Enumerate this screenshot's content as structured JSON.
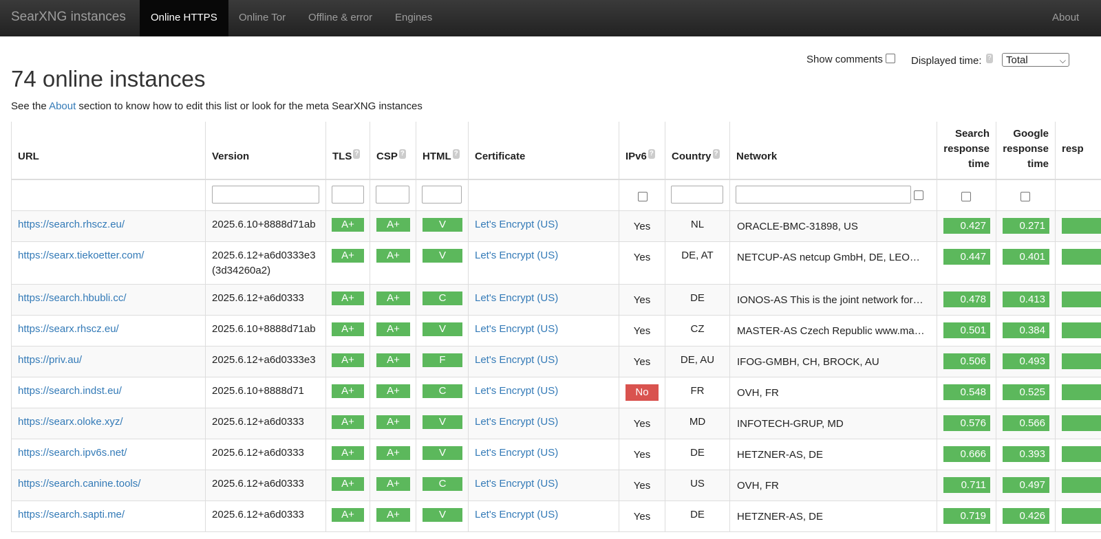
{
  "navbar": {
    "brand": "SearXNG instances",
    "tabs": [
      "Online HTTPS",
      "Online Tor",
      "Offline & error",
      "Engines"
    ],
    "about": "About"
  },
  "controls": {
    "show_comments": "Show comments",
    "displayed_time": "Displayed time:",
    "time_select": "Total"
  },
  "heading": "74 online instances",
  "subtitle": {
    "before": "See the ",
    "link": "About",
    "after": " section to know how to edit this list or look for the meta SearXNG instances"
  },
  "table": {
    "headers": {
      "url": "URL",
      "version": "Version",
      "tls": "TLS",
      "csp": "CSP",
      "html": "HTML",
      "certificate": "Certificate",
      "ipv6": "IPv6",
      "country": "Country",
      "network": "Network",
      "search": [
        "Search",
        "response",
        "time"
      ],
      "google": [
        "Google",
        "response",
        "time"
      ],
      "partial": "resp"
    },
    "rows": [
      {
        "url": "https://search.rhscz.eu/",
        "version": "2025.6.10+8888d71ab",
        "version2": "",
        "tls": "A+",
        "csp": "A+",
        "html": "V",
        "cert": "Let's Encrypt (US)",
        "ipv6": "Yes",
        "country": "NL",
        "network": "ORACLE-BMC-31898, US",
        "search": "0.427",
        "google": "0.271"
      },
      {
        "url": "https://searx.tiekoetter.com/",
        "version": "2025.6.12+a6d0333e3",
        "version2": "(3d34260a2)",
        "tls": "A+",
        "csp": "A+",
        "html": "V",
        "cert": "Let's Encrypt (US)",
        "ipv6": "Yes",
        "country": "DE, AT",
        "network": "NETCUP-AS netcup GmbH, DE, LEO…",
        "search": "0.447",
        "google": "0.401"
      },
      {
        "url": "https://search.hbubli.cc/",
        "version": "2025.6.12+a6d0333",
        "version2": "",
        "tls": "A+",
        "csp": "A+",
        "html": "C",
        "cert": "Let's Encrypt (US)",
        "ipv6": "Yes",
        "country": "DE",
        "network": "IONOS-AS This is the joint network for…",
        "search": "0.478",
        "google": "0.413"
      },
      {
        "url": "https://searx.rhscz.eu/",
        "version": "2025.6.10+8888d71ab",
        "version2": "",
        "tls": "A+",
        "csp": "A+",
        "html": "V",
        "cert": "Let's Encrypt (US)",
        "ipv6": "Yes",
        "country": "CZ",
        "network": "MASTER-AS Czech Republic www.ma…",
        "search": "0.501",
        "google": "0.384"
      },
      {
        "url": "https://priv.au/",
        "version": "2025.6.12+a6d0333e3",
        "version2": "",
        "tls": "A+",
        "csp": "A+",
        "html": "F",
        "cert": "Let's Encrypt (US)",
        "ipv6": "Yes",
        "country": "DE, AU",
        "network": "IFOG-GMBH, CH, BROCK, AU",
        "search": "0.506",
        "google": "0.493"
      },
      {
        "url": "https://search.indst.eu/",
        "version": "2025.6.10+8888d71",
        "version2": "",
        "tls": "A+",
        "csp": "A+",
        "html": "C",
        "cert": "Let's Encrypt (US)",
        "ipv6": "No",
        "country": "FR",
        "network": "OVH, FR",
        "search": "0.548",
        "google": "0.525"
      },
      {
        "url": "https://searx.oloke.xyz/",
        "version": "2025.6.12+a6d0333",
        "version2": "",
        "tls": "A+",
        "csp": "A+",
        "html": "V",
        "cert": "Let's Encrypt (US)",
        "ipv6": "Yes",
        "country": "MD",
        "network": "INFOTECH-GRUP, MD",
        "search": "0.576",
        "google": "0.566"
      },
      {
        "url": "https://search.ipv6s.net/",
        "version": "2025.6.12+a6d0333",
        "version2": "",
        "tls": "A+",
        "csp": "A+",
        "html": "V",
        "cert": "Let's Encrypt (US)",
        "ipv6": "Yes",
        "country": "DE",
        "network": "HETZNER-AS, DE",
        "search": "0.666",
        "google": "0.393"
      },
      {
        "url": "https://search.canine.tools/",
        "version": "2025.6.12+a6d0333",
        "version2": "",
        "tls": "A+",
        "csp": "A+",
        "html": "C",
        "cert": "Let's Encrypt (US)",
        "ipv6": "Yes",
        "country": "US",
        "network": "OVH, FR",
        "search": "0.711",
        "google": "0.497"
      },
      {
        "url": "https://search.sapti.me/",
        "version": "2025.6.12+a6d0333",
        "version2": "",
        "tls": "A+",
        "csp": "A+",
        "html": "V",
        "cert": "Let's Encrypt (US)",
        "ipv6": "Yes",
        "country": "DE",
        "network": "HETZNER-AS, DE",
        "search": "0.719",
        "google": "0.426"
      }
    ]
  },
  "colors": {
    "good": "#5cb85c",
    "bad": "#d9534f",
    "link": "#337ab7",
    "navbar": "#222222"
  }
}
